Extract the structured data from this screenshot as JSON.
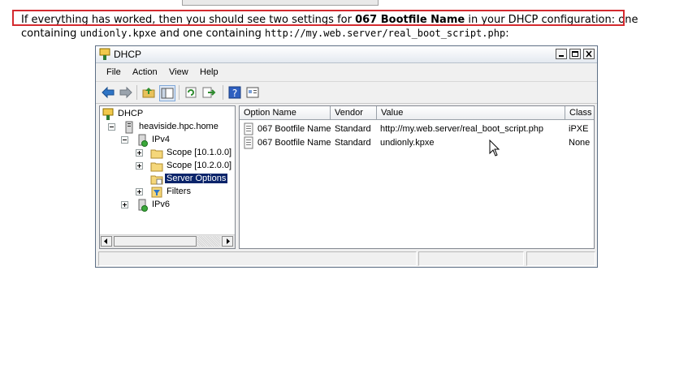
{
  "intro": {
    "part1": "If everything has worked, then you should see two settings for ",
    "bold": "067 Bootfile Name",
    "part2": " in your DHCP configuration: one containing ",
    "code1": "undionly.kpxe",
    "part3": " and one containing ",
    "code2": "http://my.web.server/real_boot_script.php",
    "part4": ":"
  },
  "window": {
    "title": "DHCP",
    "menu": [
      "File",
      "Action",
      "View",
      "Help"
    ],
    "tree": {
      "root": "DHCP",
      "server": "heaviside.hpc.home",
      "ipv4": "IPv4",
      "scope1": "Scope [10.1.0.0]",
      "scope2": "Scope [10.2.0.0]",
      "server_options": "Server Options",
      "filters": "Filters",
      "ipv6": "IPv6"
    },
    "list": {
      "columns": [
        "Option Name",
        "Vendor",
        "Value",
        "Class"
      ],
      "rows": [
        [
          "067 Bootfile Name",
          "Standard",
          "http://my.web.server/real_boot_script.php",
          "iPXE"
        ],
        [
          "067 Bootfile Name",
          "Standard",
          "undionly.kpxe",
          "None"
        ]
      ]
    }
  },
  "colors": {
    "highlight_border": "#d42a2f",
    "selection": "#0a246a"
  }
}
